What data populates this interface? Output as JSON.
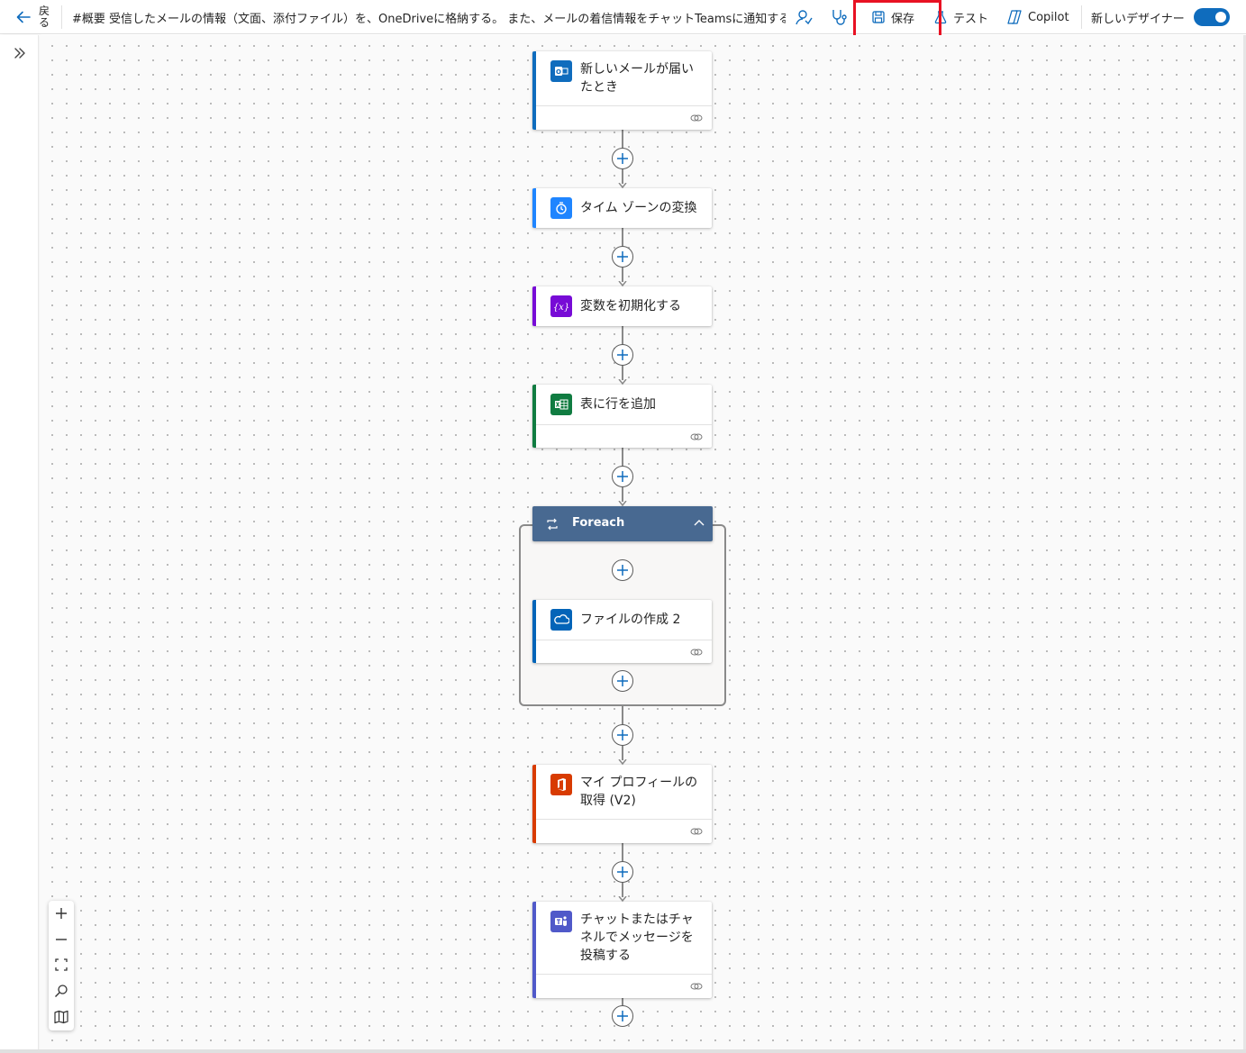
{
  "toolbar": {
    "back_label": "戻る",
    "flow_title": "#概要 受信したメールの情報（文面、添付ファイル）を、OneDriveに格納する。 また、メールの着信情報をチャットTeamsに通知する",
    "save_label": "保存",
    "test_label": "テスト",
    "copilot_label": "Copilot",
    "new_designer_label": "新しいデザイナー",
    "new_designer_on": true
  },
  "steps": {
    "trigger": {
      "title": "新しいメールが届いたとき",
      "icon": "outlook-icon",
      "color": "#0f6cbd"
    },
    "timezone": {
      "title": "タイム ゾーンの変換",
      "icon": "clock-icon",
      "color": "#1f85ff"
    },
    "variable": {
      "title": "変数を初期化する",
      "icon": "variable-icon",
      "color": "#770bd6"
    },
    "excel": {
      "title": "表に行を追加",
      "icon": "excel-icon",
      "color": "#107c41"
    },
    "foreach": {
      "title": "Foreach",
      "color": "#486991"
    },
    "onedrive": {
      "title": "ファイルの作成 2",
      "icon": "onedrive-icon",
      "color": "#0364b8"
    },
    "office": {
      "title": "マイ プロフィールの取得 (V2)",
      "icon": "office365-icon",
      "color": "#d83b01"
    },
    "teams": {
      "title": "チャットまたはチャネルでメッセージを投稿する",
      "icon": "teams-icon",
      "color": "#5059c9"
    }
  },
  "zoom_controls": [
    "zoom-in",
    "zoom-out",
    "fit-view",
    "search",
    "minimap"
  ],
  "colors": {
    "accent": "#0f6cbd",
    "highlight": "#e81123"
  }
}
